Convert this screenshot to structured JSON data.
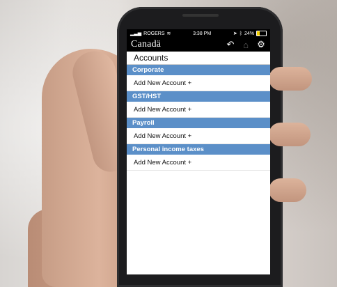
{
  "status": {
    "carrier": "ROGERS",
    "time": "3:38 PM",
    "battery_percent": 24,
    "battery_text": "24%"
  },
  "appbar": {
    "brand": "Canadä"
  },
  "page": {
    "title": "Accounts"
  },
  "sections": [
    {
      "header": "Corporate",
      "item": "Add New Account +"
    },
    {
      "header": "GST/HST",
      "item": "Add New Account +"
    },
    {
      "header": "Payroll",
      "item": "Add New Account +"
    },
    {
      "header": "Personal income taxes",
      "item": "Add New Account +"
    }
  ],
  "icons": [
    "back-icon",
    "home-icon",
    "gear-icon",
    "signal-icon",
    "wifi-icon",
    "location-icon",
    "bluetooth-icon",
    "battery-icon"
  ],
  "colors": {
    "section_header": "#5b8fc8",
    "appbar": "#000000"
  }
}
